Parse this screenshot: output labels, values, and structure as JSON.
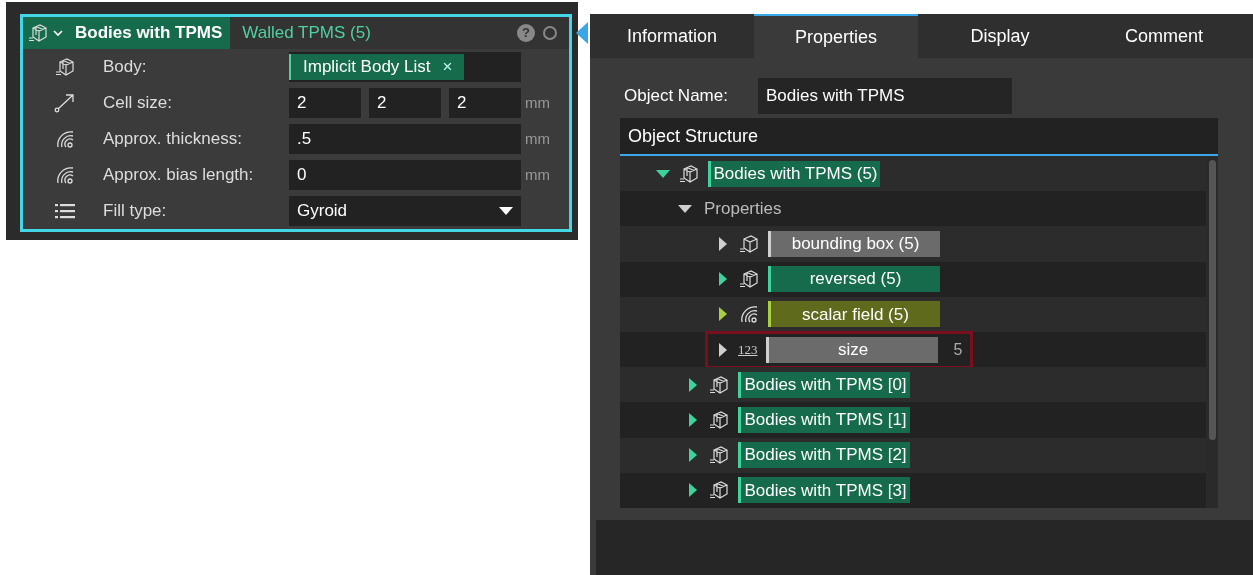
{
  "node": {
    "title": "Bodies with TPMS",
    "subtitle": "Walled TPMS (5)",
    "help": "?",
    "rows": [
      {
        "kind": "body",
        "label": "Body:",
        "chip": "Implicit Body List",
        "remove": "×"
      },
      {
        "kind": "vector",
        "label": "Cell size:",
        "values": [
          "2",
          "2",
          "2"
        ],
        "unit": "mm"
      },
      {
        "kind": "length",
        "label": "Approx. thickness:",
        "value": ".5",
        "unit": "mm"
      },
      {
        "kind": "length",
        "label": "Approx. bias length:",
        "value": "0",
        "unit": "mm"
      },
      {
        "kind": "dropdown",
        "label": "Fill type:",
        "value": "Gyroid"
      }
    ]
  },
  "tabs": [
    {
      "label": "Information",
      "selected": false
    },
    {
      "label": "Properties",
      "selected": true
    },
    {
      "label": "Display",
      "selected": false
    },
    {
      "label": "Comment",
      "selected": false
    }
  ],
  "object_name": {
    "label": "Object Name:",
    "value": "Bodies with TPMS"
  },
  "structure": {
    "title": "Object Structure",
    "tree": [
      {
        "label": "Bodies with TPMS (5)",
        "kind": "body",
        "color": "#166b4c",
        "expanded": true,
        "children": [
          {
            "label": "Properties",
            "kind": "group",
            "expanded": true,
            "children": [
              {
                "label": "bounding box (5)",
                "kind": "box",
                "color": "#6b6b6b",
                "expanded": false
              },
              {
                "label": "reversed (5)",
                "kind": "body",
                "color": "#166b4c",
                "expanded": false
              },
              {
                "label": "scalar field (5)",
                "kind": "field",
                "color": "#5f6a1c",
                "expanded": false
              },
              {
                "label": "size",
                "kind": "number",
                "icon_text": "123",
                "value": "5",
                "color": "#6b6b6b",
                "expanded": false,
                "highlighted": true
              }
            ]
          },
          {
            "label": "Bodies with TPMS [0]",
            "kind": "body",
            "color": "#166b4c",
            "expanded": false
          },
          {
            "label": "Bodies with TPMS [1]",
            "kind": "body",
            "color": "#166b4c",
            "expanded": false
          },
          {
            "label": "Bodies with TPMS [2]",
            "kind": "body",
            "color": "#166b4c",
            "expanded": false
          },
          {
            "label": "Bodies with TPMS [3]",
            "kind": "body",
            "color": "#166b4c",
            "expanded": false
          }
        ]
      }
    ]
  }
}
